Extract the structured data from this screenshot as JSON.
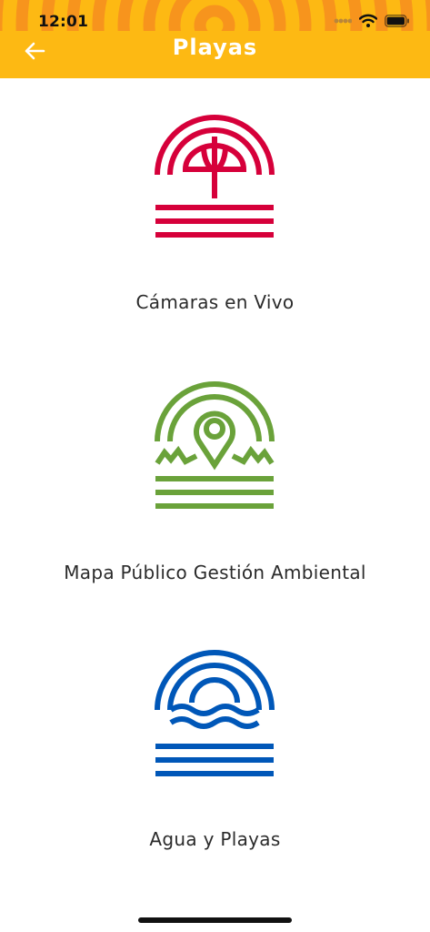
{
  "status_bar": {
    "time": "12:01"
  },
  "header": {
    "title": "Playas",
    "bg_color": "#FDB913",
    "deco_color": "#F7941D",
    "back_icon": "arrow-left-icon"
  },
  "menu": {
    "items": [
      {
        "label": "Cámaras en Vivo",
        "icon": "beach-umbrella-icon",
        "color": "#D6003A"
      },
      {
        "label": "Mapa Público Gestión Ambiental",
        "icon": "map-pin-landscape-icon",
        "color": "#6AA23A"
      },
      {
        "label": "Agua y Playas",
        "icon": "sunset-waves-icon",
        "color": "#0057B8"
      }
    ]
  }
}
